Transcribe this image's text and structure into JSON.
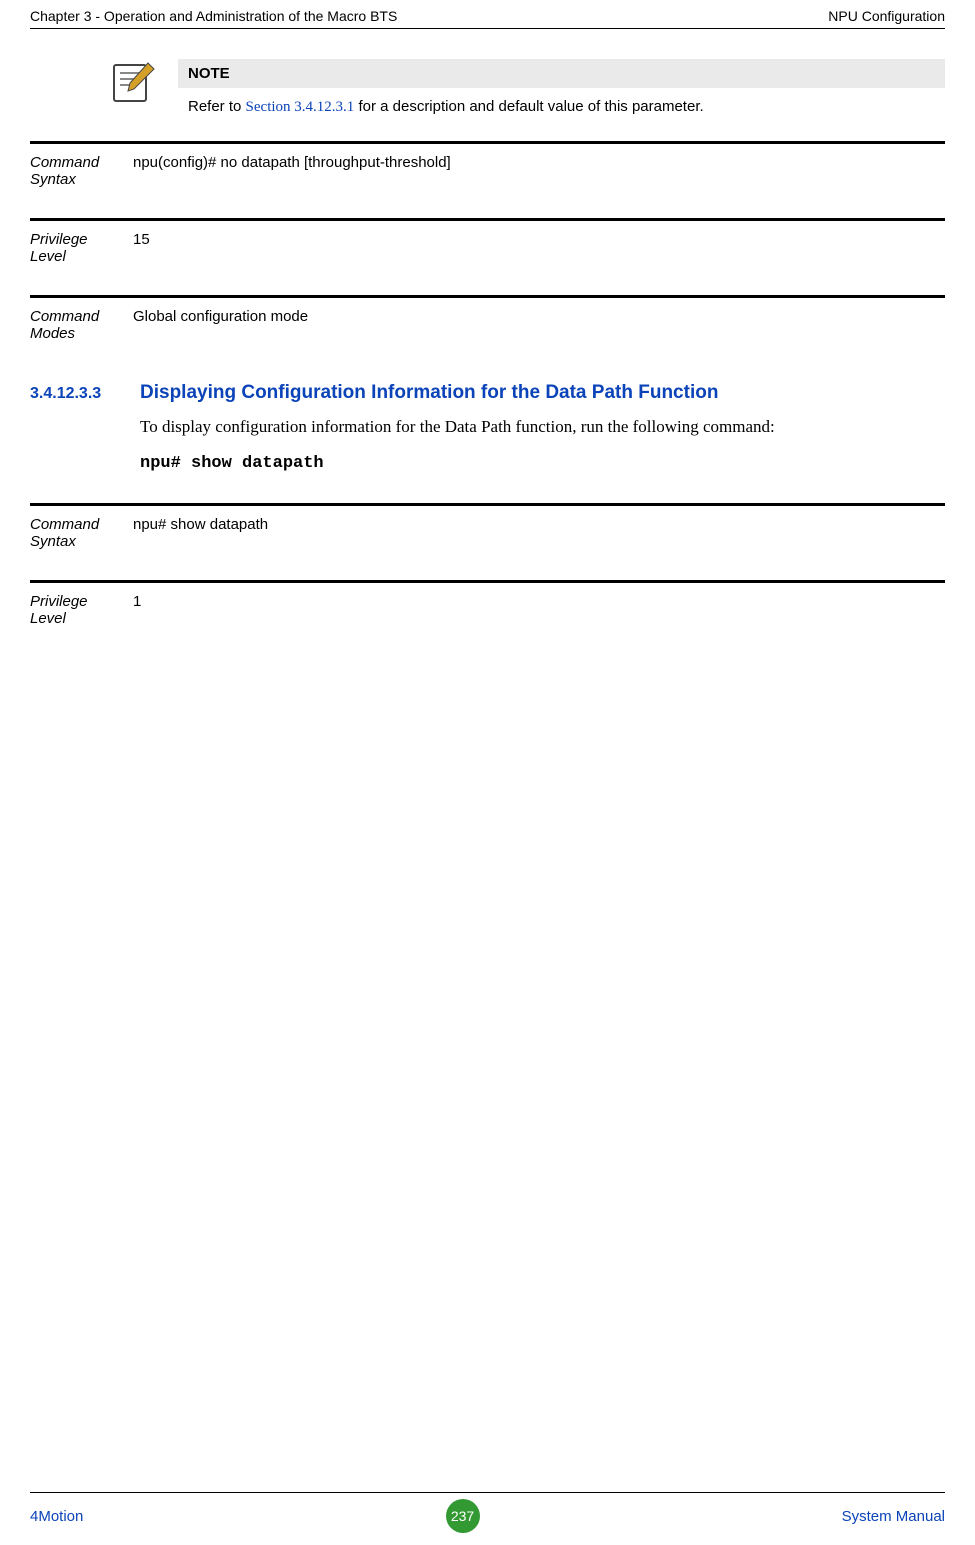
{
  "header": {
    "left": "Chapter 3 - Operation and Administration of the Macro BTS",
    "right": "NPU Configuration"
  },
  "note": {
    "title": "NOTE",
    "prefix": "Refer to ",
    "link": "Section 3.4.12.3.1",
    "suffix": " for a description and default value of this parameter."
  },
  "rows1": {
    "syntax_label": "Command Syntax",
    "syntax_value": "npu(config)# no datapath [throughput-threshold]",
    "priv_label": "Privilege Level",
    "priv_value": "15",
    "modes_label": "Command Modes",
    "modes_value": "Global configuration mode"
  },
  "section": {
    "num": "3.4.12.3.3",
    "title": "Displaying Configuration Information for the Data Path Function",
    "body": "To display configuration information for the Data Path function, run the following command:",
    "cmd": "npu# show datapath"
  },
  "rows2": {
    "syntax_label": "Command Syntax",
    "syntax_value": "npu# show datapath",
    "priv_label": "Privilege Level",
    "priv_value": "1"
  },
  "footer": {
    "left": "4Motion",
    "page": "237",
    "right": "System Manual"
  }
}
